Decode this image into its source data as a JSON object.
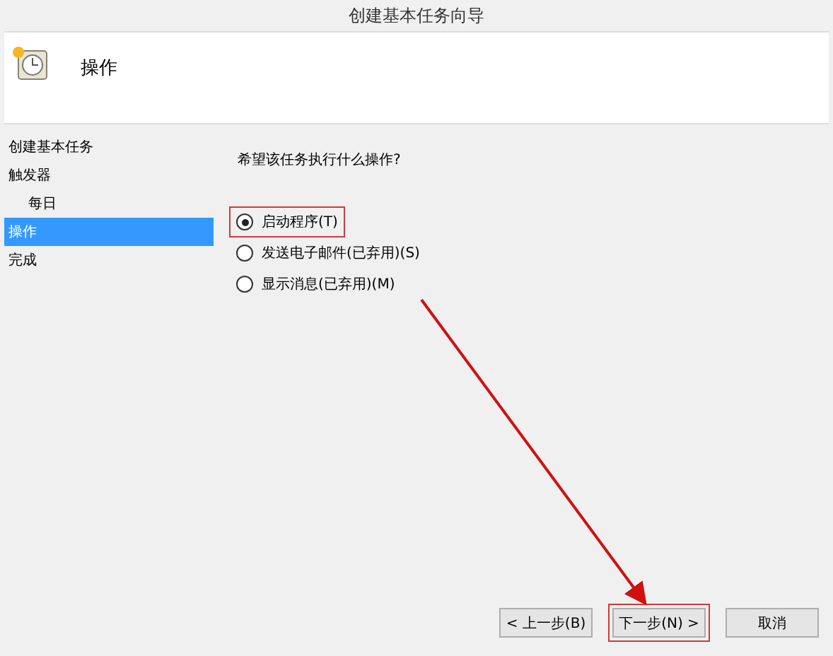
{
  "window": {
    "title": "创建基本任务向导"
  },
  "header": {
    "title": "操作"
  },
  "sidebar": {
    "items": [
      {
        "label": "创建基本任务",
        "selected": false
      },
      {
        "label": "触发器",
        "selected": false,
        "children": [
          {
            "label": "每日",
            "selected": false
          }
        ]
      },
      {
        "label": "操作",
        "selected": true
      },
      {
        "label": "完成",
        "selected": false
      }
    ]
  },
  "question": "希望该任务执行什么操作?",
  "options": [
    {
      "label": "启动程序(T)",
      "selected": true,
      "highlighted": true
    },
    {
      "label": "发送电子邮件(已弃用)(S)",
      "selected": false,
      "highlighted": false
    },
    {
      "label": "显示消息(已弃用)(M)",
      "selected": false,
      "highlighted": false
    }
  ],
  "buttons": [
    {
      "label": "< 上一步(B)",
      "highlighted": false
    },
    {
      "label": "下一步(N) >",
      "highlighted": true
    },
    {
      "label": "取消",
      "highlighted": false
    }
  ]
}
